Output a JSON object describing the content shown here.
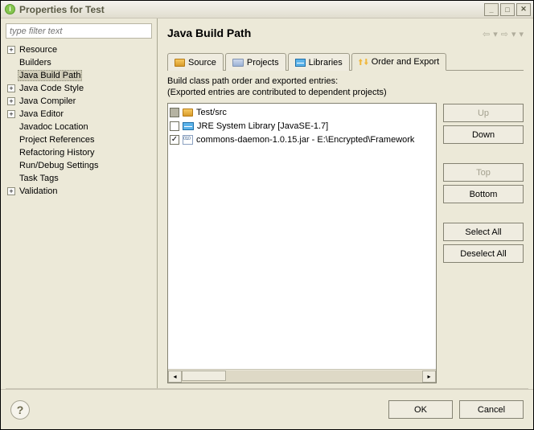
{
  "window": {
    "title": "Properties for Test"
  },
  "filter": {
    "placeholder": "type filter text"
  },
  "tree": {
    "items": [
      {
        "label": "Resource",
        "expandable": true,
        "indent": 0
      },
      {
        "label": "Builders",
        "expandable": false,
        "indent": 1
      },
      {
        "label": "Java Build Path",
        "expandable": false,
        "indent": 1,
        "selected": true
      },
      {
        "label": "Java Code Style",
        "expandable": true,
        "indent": 0
      },
      {
        "label": "Java Compiler",
        "expandable": true,
        "indent": 0
      },
      {
        "label": "Java Editor",
        "expandable": true,
        "indent": 0
      },
      {
        "label": "Javadoc Location",
        "expandable": false,
        "indent": 1
      },
      {
        "label": "Project References",
        "expandable": false,
        "indent": 1
      },
      {
        "label": "Refactoring History",
        "expandable": false,
        "indent": 1
      },
      {
        "label": "Run/Debug Settings",
        "expandable": false,
        "indent": 1
      },
      {
        "label": "Task Tags",
        "expandable": false,
        "indent": 1
      },
      {
        "label": "Validation",
        "expandable": true,
        "indent": 0
      }
    ]
  },
  "page": {
    "title": "Java Build Path"
  },
  "tabs": [
    {
      "label": "Source",
      "icon": "source"
    },
    {
      "label": "Projects",
      "icon": "projects"
    },
    {
      "label": "Libraries",
      "icon": "libs"
    },
    {
      "label": "Order and Export",
      "icon": "order",
      "active": true
    }
  ],
  "info": {
    "line1": "Build class path order and exported entries:",
    "line2": "(Exported entries are contributed to dependent projects)"
  },
  "entries": [
    {
      "label": "Test/src",
      "icon": "src",
      "check": "filled"
    },
    {
      "label": "JRE System Library [JavaSE-1.7]",
      "icon": "jre",
      "check": "unchecked"
    },
    {
      "label": "commons-daemon-1.0.15.jar - E:\\Encrypted\\Framework",
      "icon": "jar",
      "check": "checked"
    }
  ],
  "buttons": {
    "up": "Up",
    "down": "Down",
    "top": "Top",
    "bottom": "Bottom",
    "select_all": "Select All",
    "deselect_all": "Deselect All"
  },
  "dialog": {
    "ok": "OK",
    "cancel": "Cancel"
  }
}
